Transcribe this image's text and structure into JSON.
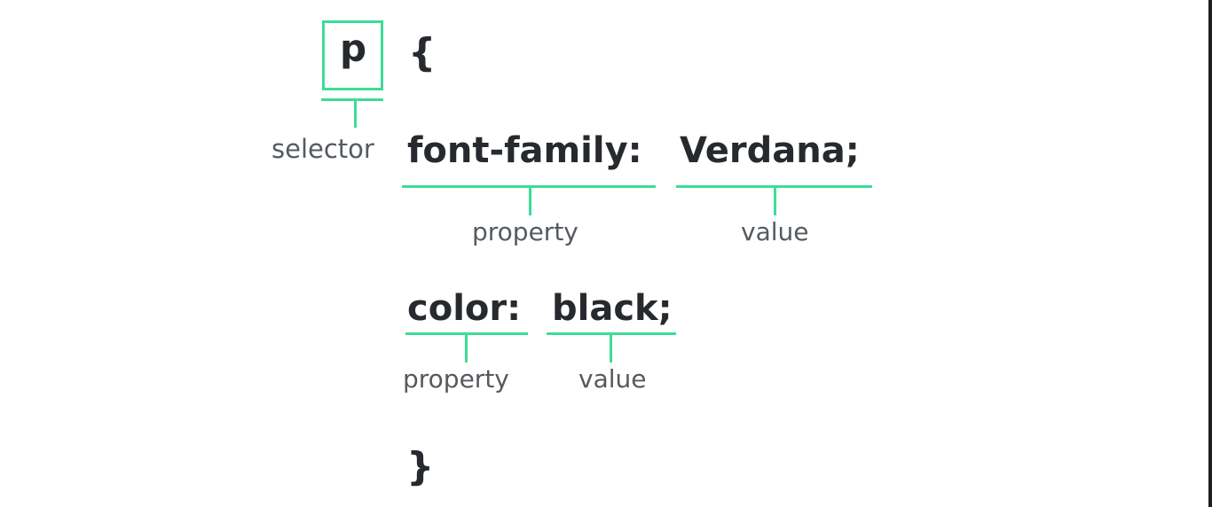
{
  "colors": {
    "accent": "#3ddc97",
    "code_text": "#262a2e",
    "label_text": "#555a5f"
  },
  "rule": {
    "selector": "p",
    "open_brace": "{",
    "close_brace": "}",
    "declarations": [
      {
        "property": "font-family:",
        "value": "Verdana;"
      },
      {
        "property": "color:",
        "value": "black;"
      }
    ]
  },
  "labels": {
    "selector": "selector",
    "property": "property",
    "value": "value"
  }
}
